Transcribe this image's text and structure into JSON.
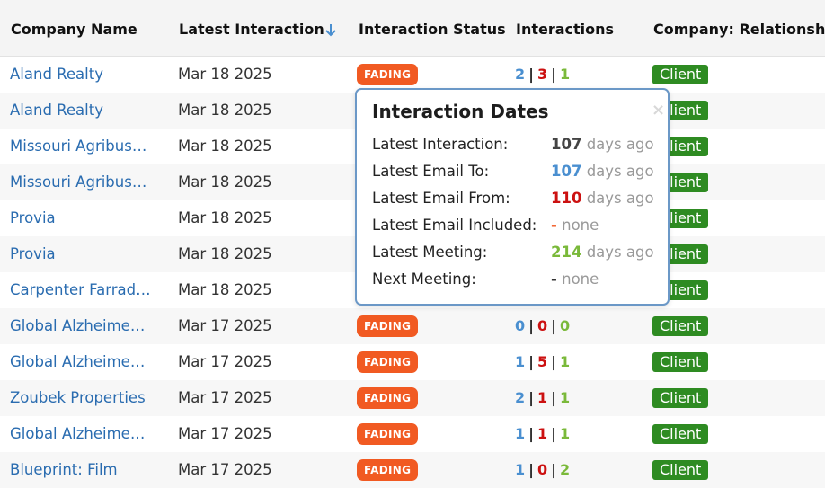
{
  "table": {
    "columns": [
      "Company Name",
      "Latest Interaction",
      "Interaction Status",
      "Interactions",
      "Company: Relationship"
    ],
    "rows": [
      {
        "name": "Aland Realty",
        "date": "Mar 18 2025",
        "status": "FADING",
        "i1": "2",
        "i2": "3",
        "i3": "1",
        "rel": "Client"
      },
      {
        "name": "Aland Realty",
        "date": "Mar 18 2025",
        "status": "",
        "i1": "",
        "i2": "",
        "i3": "",
        "rel": "Client"
      },
      {
        "name": "Missouri Agribus…",
        "date": "Mar 18 2025",
        "status": "",
        "i1": "",
        "i2": "",
        "i3": "",
        "rel": "Client"
      },
      {
        "name": "Missouri Agribus…",
        "date": "Mar 18 2025",
        "status": "",
        "i1": "",
        "i2": "",
        "i3": "",
        "rel": "Client"
      },
      {
        "name": "Provia",
        "date": "Mar 18 2025",
        "status": "",
        "i1": "",
        "i2": "",
        "i3": "",
        "rel": "Client"
      },
      {
        "name": "Provia",
        "date": "Mar 18 2025",
        "status": "",
        "i1": "",
        "i2": "",
        "i3": "",
        "rel": "Client"
      },
      {
        "name": "Carpenter Farrad…",
        "date": "Mar 18 2025",
        "status": "",
        "i1": "",
        "i2": "",
        "i3": "",
        "rel": "Client"
      },
      {
        "name": "Global Alzheime…",
        "date": "Mar 17 2025",
        "status": "FADING",
        "i1": "0",
        "i2": "0",
        "i3": "0",
        "rel": "Client"
      },
      {
        "name": "Global Alzheime…",
        "date": "Mar 17 2025",
        "status": "FADING",
        "i1": "1",
        "i2": "5",
        "i3": "1",
        "rel": "Client"
      },
      {
        "name": "Zoubek Properties",
        "date": "Mar 17 2025",
        "status": "FADING",
        "i1": "2",
        "i2": "1",
        "i3": "1",
        "rel": "Client"
      },
      {
        "name": "Global Alzheime…",
        "date": "Mar 17 2025",
        "status": "FADING",
        "i1": "1",
        "i2": "1",
        "i3": "1",
        "rel": "Client"
      },
      {
        "name": "Blueprint: Film",
        "date": "Mar 17 2025",
        "status": "FADING",
        "i1": "1",
        "i2": "0",
        "i3": "2",
        "rel": "Client"
      }
    ]
  },
  "popup": {
    "title": "Interaction Dates",
    "close": "×",
    "lines": [
      {
        "label": "Latest Interaction:",
        "num": "107",
        "unit": "days ago",
        "color": "gray"
      },
      {
        "label": "Latest Email To:",
        "num": "107",
        "unit": "days ago",
        "color": "blue"
      },
      {
        "label": "Latest Email From:",
        "num": "110",
        "unit": "days ago",
        "color": "red"
      },
      {
        "label": "Latest Email Included:",
        "num": "-",
        "unit": "none",
        "color": "orange"
      },
      {
        "label": "Latest Meeting:",
        "num": "214",
        "unit": "days ago",
        "color": "green"
      },
      {
        "label": "Next Meeting:",
        "num": "-",
        "unit": "none",
        "color": "dark"
      }
    ]
  },
  "colors": {
    "link": "#2a6cb0",
    "fading": "#f15a22",
    "client": "#2e8b22",
    "popup_border": "#6b98c7"
  },
  "icons": {
    "sort": "arrow-down-icon",
    "close": "close-icon"
  }
}
